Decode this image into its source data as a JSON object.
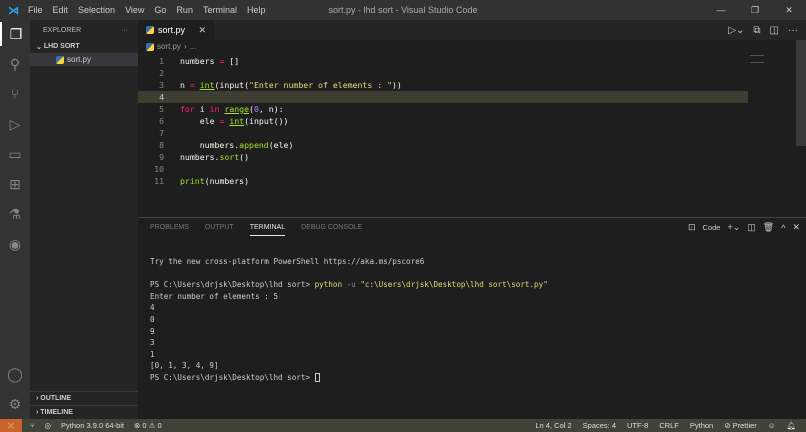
{
  "titlebar": {
    "menu": [
      "File",
      "Edit",
      "Selection",
      "View",
      "Go",
      "Run",
      "Terminal",
      "Help"
    ],
    "title": "sort.py - lhd sort - Visual Studio Code"
  },
  "sidebar": {
    "header": "EXPLORER",
    "more": "···",
    "folder": "LHD SORT",
    "file": "sort.py",
    "outline": "OUTLINE",
    "timeline": "TIMELINE"
  },
  "editor": {
    "tab": "sort.py",
    "breadcrumb": "sort.py",
    "breadcrumb_more": "...",
    "lines": [
      "1",
      "2",
      "3",
      "4",
      "5",
      "6",
      "7",
      "8",
      "9",
      "10",
      "11"
    ]
  },
  "panel": {
    "tabs": [
      "PROBLEMS",
      "OUTPUT",
      "TERMINAL",
      "DEBUG CONSOLE"
    ],
    "shell": "Code",
    "terminal": {
      "line1": "Try the new cross-platform PowerShell https://aka.ms/pscore6",
      "prompt": "PS C:\\Users\\drjsk\\Desktop\\lhd sort> ",
      "cmd": "python",
      "flag": " -u ",
      "arg": "\"c:\\Users\\drjsk\\Desktop\\lhd sort\\sort.py\"",
      "out": [
        "Enter number of elements : 5",
        "4",
        "0",
        "9",
        "3",
        "1",
        "[0, 1, 3, 4, 9]"
      ],
      "final_prompt": "PS C:\\Users\\drjsk\\Desktop\\lhd sort> "
    }
  },
  "status": {
    "python": "Python 3.9.0 64-bit",
    "errors": "0",
    "warnings": "0",
    "position": "Ln 4, Col 2",
    "spaces": "Spaces: 4",
    "encoding": "UTF-8",
    "eol": "CRLF",
    "language": "Python",
    "prettier": "Prettier"
  }
}
